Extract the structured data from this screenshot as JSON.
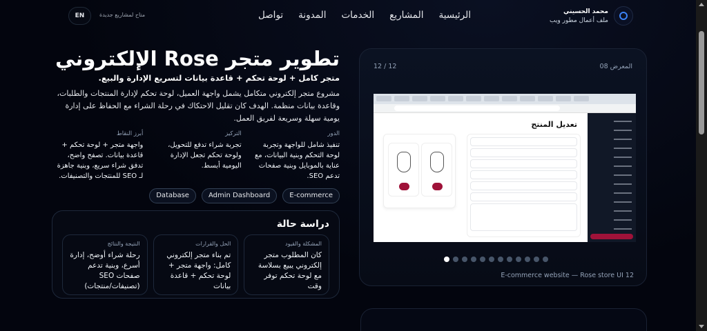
{
  "header": {
    "nav": [
      "الرئيسية",
      "المشاريع",
      "الخدمات",
      "المدونة",
      "تواصل"
    ],
    "brand_name": "محمد الحسيني",
    "brand_sub": "ملف أعمال مطور ويب",
    "availability": "متاح لمشاريع جديدة",
    "lang_button": "EN"
  },
  "project": {
    "title": "تطوير متجر Rose الإلكتروني",
    "subtitle": "متجر كامل + لوحة تحكم + قاعدة بيانات لتسريع الإدارة والبيع.",
    "description": "مشروع متجر إلكتروني متكامل يشمل واجهة العميل، لوحة تحكم لإدارة المنتجات والطلبات، وقاعدة بيانات منظمة. الهدف كان تقليل الاحتكاك في رحلة الشراء مع الحفاظ على إدارة يومية سهلة وسريعة لفريق العمل.",
    "columns": [
      {
        "label": "الدور",
        "text": "تنفيذ شامل للواجهة وتجربة لوحة التحكم وبنية البيانات، مع عناية بالموبايل وبنية صفحات تدعم SEO."
      },
      {
        "label": "التركيز",
        "text": "تجربة شراء تدفع للتحويل، ولوحة تحكم تجعل الإدارة اليومية أبسط."
      },
      {
        "label": "أبرز النقاط",
        "text": "واجهة متجر + لوحة تحكم + قاعدة بيانات. تصفح واضح، تدفق شراء سريع، وبنية جاهزة لـ SEO للمنتجات والتصنيفات."
      }
    ],
    "tags": [
      "E-commerce",
      "Admin Dashboard",
      "Database"
    ]
  },
  "case_study": {
    "title": "دراسة حالة",
    "cards": [
      {
        "label": "المشكلة والقيود",
        "text": "كان المطلوب متجر إلكتروني يبيع بسلاسة مع لوحة تحكم توفر وقت"
      },
      {
        "label": "الحل والقرارات",
        "text": "تم بناء متجر إلكتروني كامل: واجهة متجر + لوحة تحكم + قاعدة بيانات"
      },
      {
        "label": "النتيجة والنتائج",
        "text": "رحلة شراء أوضح، إدارة أسرع، وبنية تدعم صفحات SEO (تصنيفات/منتجات)"
      }
    ]
  },
  "gallery": {
    "label": "المعرض 08",
    "counter": "12 / 12",
    "screenshot_heading": "تعديل المنتج",
    "slide_count": 12,
    "active_slide": 1,
    "caption": "E-commerce website — Rose store UI 12"
  }
}
